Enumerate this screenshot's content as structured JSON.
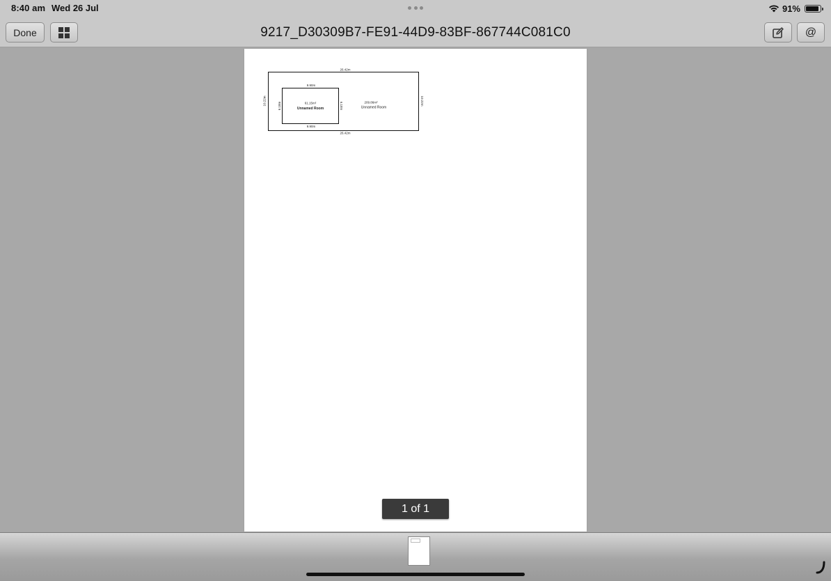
{
  "status_bar": {
    "time": "8:40 am",
    "date": "Wed 26 Jul",
    "battery_text": "91%",
    "battery_level": 0.91,
    "icons": [
      "wifi-icon",
      "battery-icon"
    ]
  },
  "toolbar": {
    "done_label": "Done",
    "title": "9217_D30309B7-FE91-44D9-83BF-867744C081C0",
    "at_label": "@",
    "icons": [
      "grid-icon",
      "edit-icon"
    ]
  },
  "floorplan": {
    "outer_top": "26.42m",
    "outer_bottom": "26.42m",
    "outer_left": "10.22m",
    "outer_right": "10.22m",
    "inner_top": "9.90m",
    "inner_bottom": "9.90m",
    "inner_left": "6.18m",
    "inner_right": "6.18m",
    "inner_area": "61.15m²",
    "inner_name": "Unnamed Room",
    "outer_area": "209.86m²",
    "outer_name": "Unnamed Room"
  },
  "page_indicator": "1 of 1"
}
